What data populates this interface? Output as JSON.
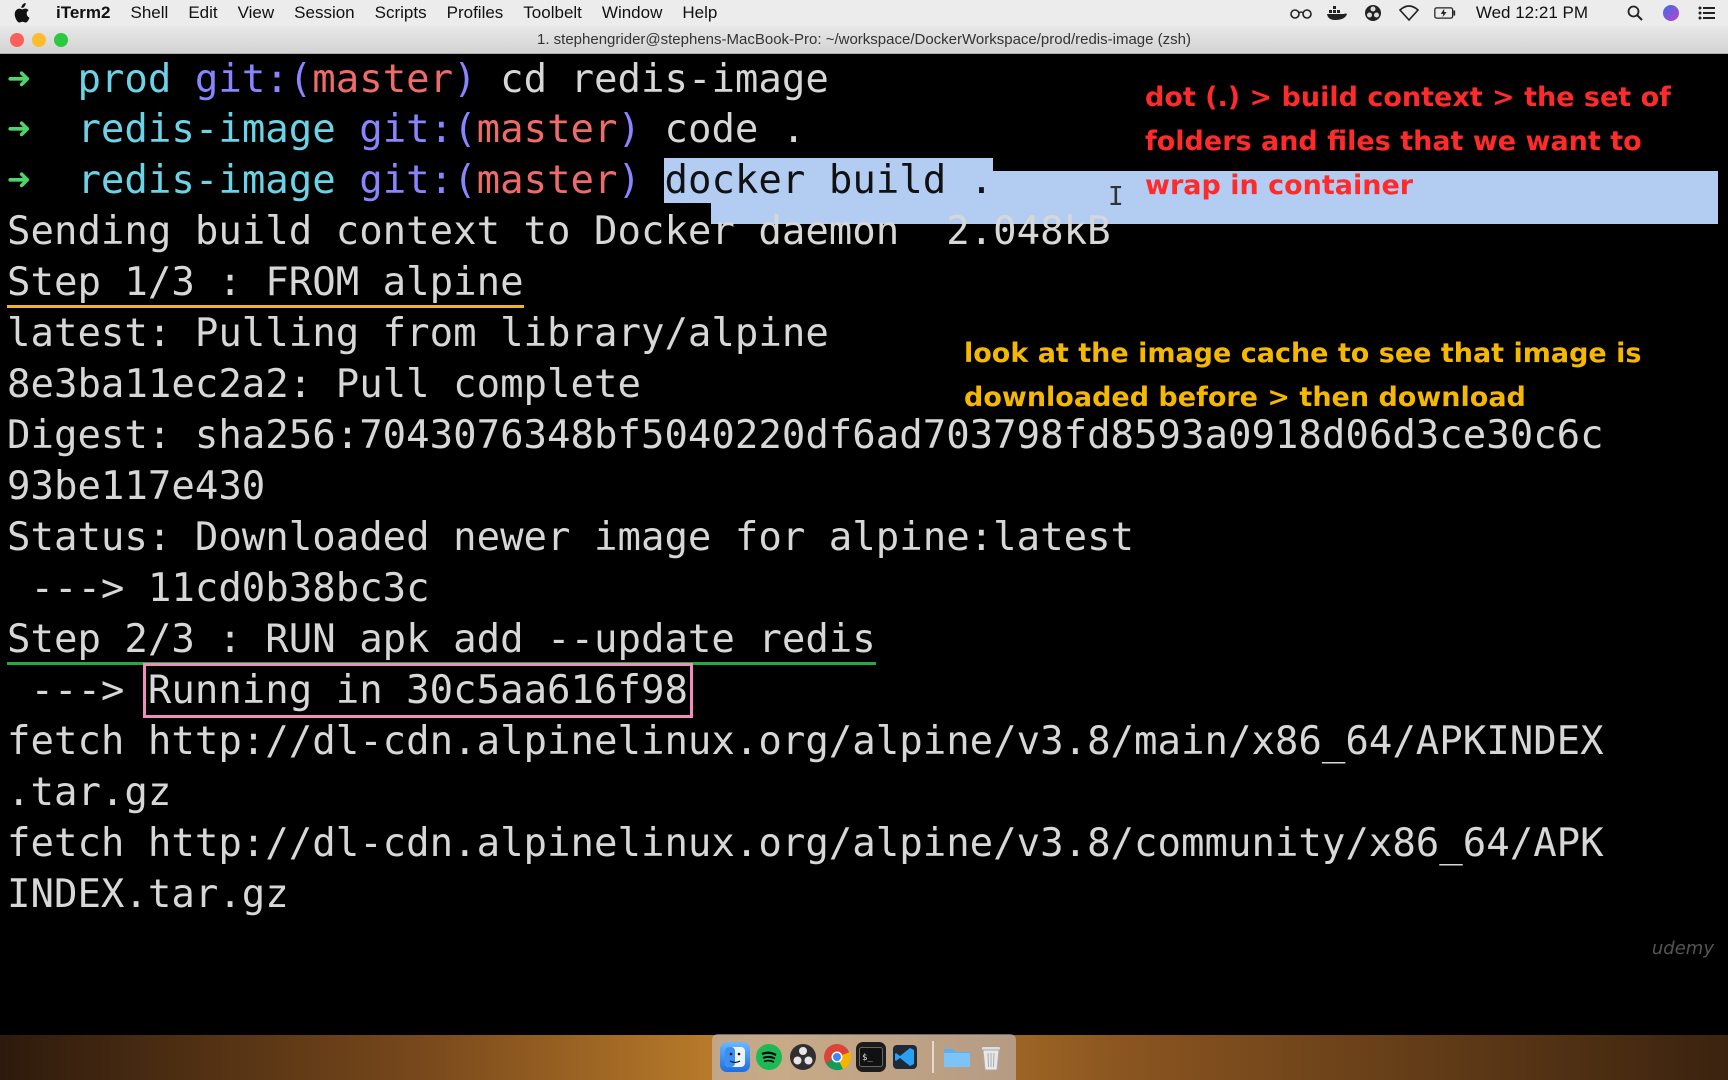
{
  "menubar": {
    "app_name": "iTerm2",
    "items": [
      "Shell",
      "Edit",
      "View",
      "Session",
      "Scripts",
      "Profiles",
      "Toolbelt",
      "Window",
      "Help"
    ],
    "clock": "Wed 12:21 PM",
    "status_icons": [
      "glasses-icon",
      "docker-icon",
      "obs-icon",
      "wifi-icon",
      "battery-icon",
      "search-icon",
      "siri-icon",
      "notification-center-icon"
    ]
  },
  "window": {
    "title": "1. stephengrider@stephens-MacBook-Pro: ~/workspace/DockerWorkspace/prod/redis-image (zsh)"
  },
  "terminal": {
    "prompt_arrow": "➜",
    "prompts": [
      {
        "dir": "prod",
        "git": "git:(",
        "branch": "master",
        "git_close": ")",
        "command": "cd redis-image"
      },
      {
        "dir": "redis-image",
        "git": "git:(",
        "branch": "master",
        "git_close": ")",
        "command": "code ."
      },
      {
        "dir": "redis-image",
        "git": "git:(",
        "branch": "master",
        "git_close": ")",
        "command": "docker build ."
      }
    ],
    "output": {
      "sending": "Sending build context to Docker daemon  2.048kB",
      "step1": "Step 1/3 : FROM alpine",
      "pulling": "latest: Pulling from library/alpine",
      "pull_complete": "8e3ba11ec2a2: Pull complete",
      "digest_1": "Digest: sha256:7043076348bf5040220df6ad703798fd8593a0918d06d3ce30c6c",
      "digest_2": "93be117e430",
      "status": "Status: Downloaded newer image for alpine:latest",
      "id_arrow": " ---> 11cd0b38bc3c",
      "step2": "Step 2/3 : RUN apk add --update redis",
      "running_prefix": " ---> ",
      "running": "Running in 30c5aa616f98",
      "fetch1_1": "fetch http://dl-cdn.alpinelinux.org/alpine/v3.8/main/x86_64/APKINDEX",
      "fetch1_2": ".tar.gz",
      "fetch2_1": "fetch http://dl-cdn.alpinelinux.org/alpine/v3.8/community/x86_64/APK",
      "fetch2_2": "INDEX.tar.gz"
    }
  },
  "annotations": {
    "red_note": "dot (.) > build context > the set of folders and files that we want to wrap in container",
    "orange_note": "look at the image cache to see that image is downloaded before > then download"
  },
  "watermark": "udemy",
  "dock": {
    "apps": [
      "finder-icon",
      "spotify-icon",
      "obs-icon",
      "chrome-icon",
      "terminal-icon",
      "vscode-icon"
    ],
    "others": [
      "folder-icon",
      "trash-icon"
    ]
  },
  "colors": {
    "prompt_arrow": "#4fd46a",
    "dir": "#6cd3e6",
    "git": "#8a85ff",
    "branch": "#ee6b6b",
    "red_note": "#ff2a2a",
    "orange_note": "#f5b800",
    "step1_underline": "#f0b324",
    "step2_underline": "#28a745",
    "running_box": "#f08cc0",
    "selection": "#b3cdf2"
  }
}
